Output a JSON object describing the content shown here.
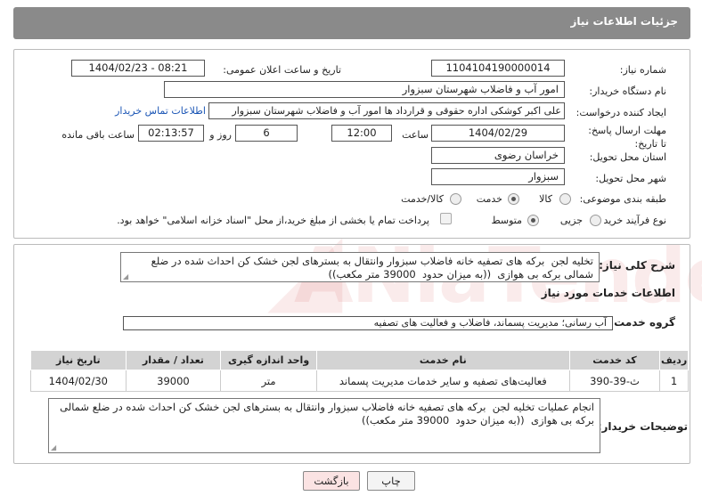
{
  "header": {
    "title": "جزئیات اطلاعات نیاز"
  },
  "form": {
    "need_number_label": "شماره نیاز:",
    "need_number": "1104104190000014",
    "announce_label": "تاریخ و ساعت اعلان عمومی:",
    "announce_value": "1404/02/23 - 08:21",
    "buyer_org_label": "نام دستگاه خریدار:",
    "buyer_org": "امور آب و فاضلاب شهرستان سبزوار",
    "creator_label": "ایجاد کننده درخواست:",
    "creator": "علی اکبر کوشکی اداره حقوقی و قرارداد ها امور آب و فاضلاب شهرستان سبزوار",
    "contact_link": "اطلاعات تماس خریدار",
    "deadline_label": "مهلت ارسال پاسخ: تا تاریخ:",
    "deadline_date": "1404/02/29",
    "time_label": "ساعت",
    "deadline_time": "12:00",
    "days_value": "6",
    "days_label": "روز و",
    "remaining_time": "02:13:57",
    "remaining_label": "ساعت باقی مانده",
    "province_label": "استان محل تحویل:",
    "province": "خراسان رضوی",
    "city_label": "شهر محل تحویل:",
    "city": "سبزوار",
    "category_label": "طبقه بندی موضوعی:",
    "category_options": [
      "کالا",
      "خدمت",
      "کالا/خدمت"
    ],
    "category_selected": "خدمت",
    "process_label": "نوع فرآیند خرید :",
    "process_options": [
      "جزیی",
      "متوسط"
    ],
    "process_selected": "متوسط",
    "treasury_note": "پرداخت تمام یا بخشی از مبلغ خرید،از محل \"اسناد خزانه اسلامی\" خواهد بود."
  },
  "summary": {
    "label": "شرح کلی نیاز:",
    "text": "تخلیه لجن  برکه های تصفیه خانه فاضلاب سبزوار وانتقال به بسترهای لجن خشک کن احداث شده در ضلع شمالی برکه بی هوازی  ((به میزان حدود  39000 متر مکعب))"
  },
  "services": {
    "section_title": "اطلاعات خدمات مورد نیاز",
    "group_label": "گروه خدمت:",
    "group_value": "آب رسانی؛ مدیریت پسماند، فاضلاب و فعالیت های تصفیه",
    "columns": [
      "ردیف",
      "کد خدمت",
      "نام خدمت",
      "واحد اندازه گیری",
      "تعداد / مقدار",
      "تاریخ نیاز"
    ],
    "rows": [
      [
        "1",
        "ث-39-390",
        "فعالیت‌های تصفیه و سایر خدمات مدیریت پسماند",
        "متر",
        "39000",
        "1404/02/30"
      ]
    ]
  },
  "buyer_notes": {
    "label": "توضیحات خریدار:",
    "text": "انجام عملیات تخلیه لجن  برکه های تصفیه خانه فاضلاب سبزوار وانتقال به بسترهای لجن خشک کن احداث شده در ضلع شمالی برکه بی هوازی  ((به میزان حدود  39000 متر مکعب))"
  },
  "buttons": {
    "print": "چاپ",
    "back": "بازگشت"
  },
  "colors": {
    "header_bg": "#8a8a8a",
    "link": "#1a55b5",
    "back_button_bg": "#fbe3e3"
  }
}
